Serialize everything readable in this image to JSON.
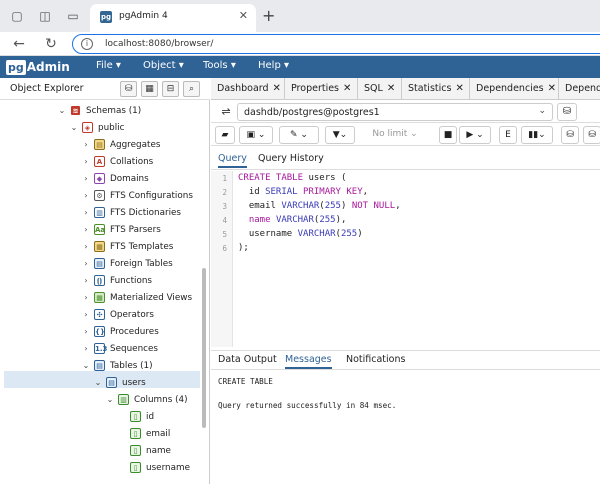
{
  "browser": {
    "tab_title": "pgAdmin 4",
    "tab_favicon": "pg",
    "new_tab_label": "+",
    "url": "localhost:8080/browser/"
  },
  "app": {
    "logo_pg": "pg",
    "logo_admin": "Admin",
    "menu": [
      "File ▾",
      "Object ▾",
      "Tools ▾",
      "Help ▾"
    ]
  },
  "explorer": {
    "title": "Object Explorer",
    "tree": [
      {
        "label": "Schemas (1)",
        "icon": "schemas-icon",
        "chev": "⌄"
      },
      {
        "label": "public",
        "icon": "schema-icon",
        "chev": "⌄"
      },
      {
        "label": "Aggregates",
        "icon": "aggregates-icon",
        "chev": "›"
      },
      {
        "label": "Collations",
        "icon": "collations-icon",
        "chev": "›"
      },
      {
        "label": "Domains",
        "icon": "domains-icon",
        "chev": "›"
      },
      {
        "label": "FTS Configurations",
        "icon": "fts-config-icon",
        "chev": "›"
      },
      {
        "label": "FTS Dictionaries",
        "icon": "fts-dict-icon",
        "chev": "›"
      },
      {
        "label": "FTS Parsers",
        "icon": "fts-parser-icon",
        "chev": "›"
      },
      {
        "label": "FTS Templates",
        "icon": "fts-template-icon",
        "chev": "›"
      },
      {
        "label": "Foreign Tables",
        "icon": "foreign-table-icon",
        "chev": "›"
      },
      {
        "label": "Functions",
        "icon": "function-icon",
        "chev": "›"
      },
      {
        "label": "Materialized Views",
        "icon": "matview-icon",
        "chev": "›"
      },
      {
        "label": "Operators",
        "icon": "operator-icon",
        "chev": "›"
      },
      {
        "label": "Procedures",
        "icon": "procedure-icon",
        "chev": "›"
      },
      {
        "label": "Sequences",
        "icon": "sequence-icon",
        "chev": "›"
      },
      {
        "label": "Tables (1)",
        "icon": "tables-icon",
        "chev": "⌄"
      },
      {
        "label": "users",
        "icon": "table-icon",
        "chev": "⌄"
      },
      {
        "label": "Columns (4)",
        "icon": "columns-icon",
        "chev": "⌄"
      },
      {
        "label": "id",
        "icon": "column-icon",
        "chev": ""
      },
      {
        "label": "email",
        "icon": "column-icon",
        "chev": ""
      },
      {
        "label": "name",
        "icon": "column-icon",
        "chev": ""
      },
      {
        "label": "username",
        "icon": "column-icon",
        "chev": ""
      }
    ]
  },
  "dock_tabs": [
    "Dashboard",
    "Properties",
    "SQL",
    "Statistics",
    "Dependencies",
    "Dependents"
  ],
  "query_tool": {
    "connection": "dashdb/postgres@postgres1",
    "limit": "No limit",
    "tabs": [
      "Query",
      "Query History"
    ],
    "line_numbers": [
      "1",
      "2",
      "3",
      "4",
      "5",
      "6"
    ],
    "output_tabs": [
      "Data Output",
      "Messages",
      "Notifications"
    ],
    "messages": [
      "CREATE TABLE",
      "Query returned successfully in 84 msec."
    ]
  },
  "colors": {
    "brand": "#2f6295",
    "keyword": "#a8179b",
    "type": "#3a3ab8",
    "selection": "#dde8f5"
  }
}
